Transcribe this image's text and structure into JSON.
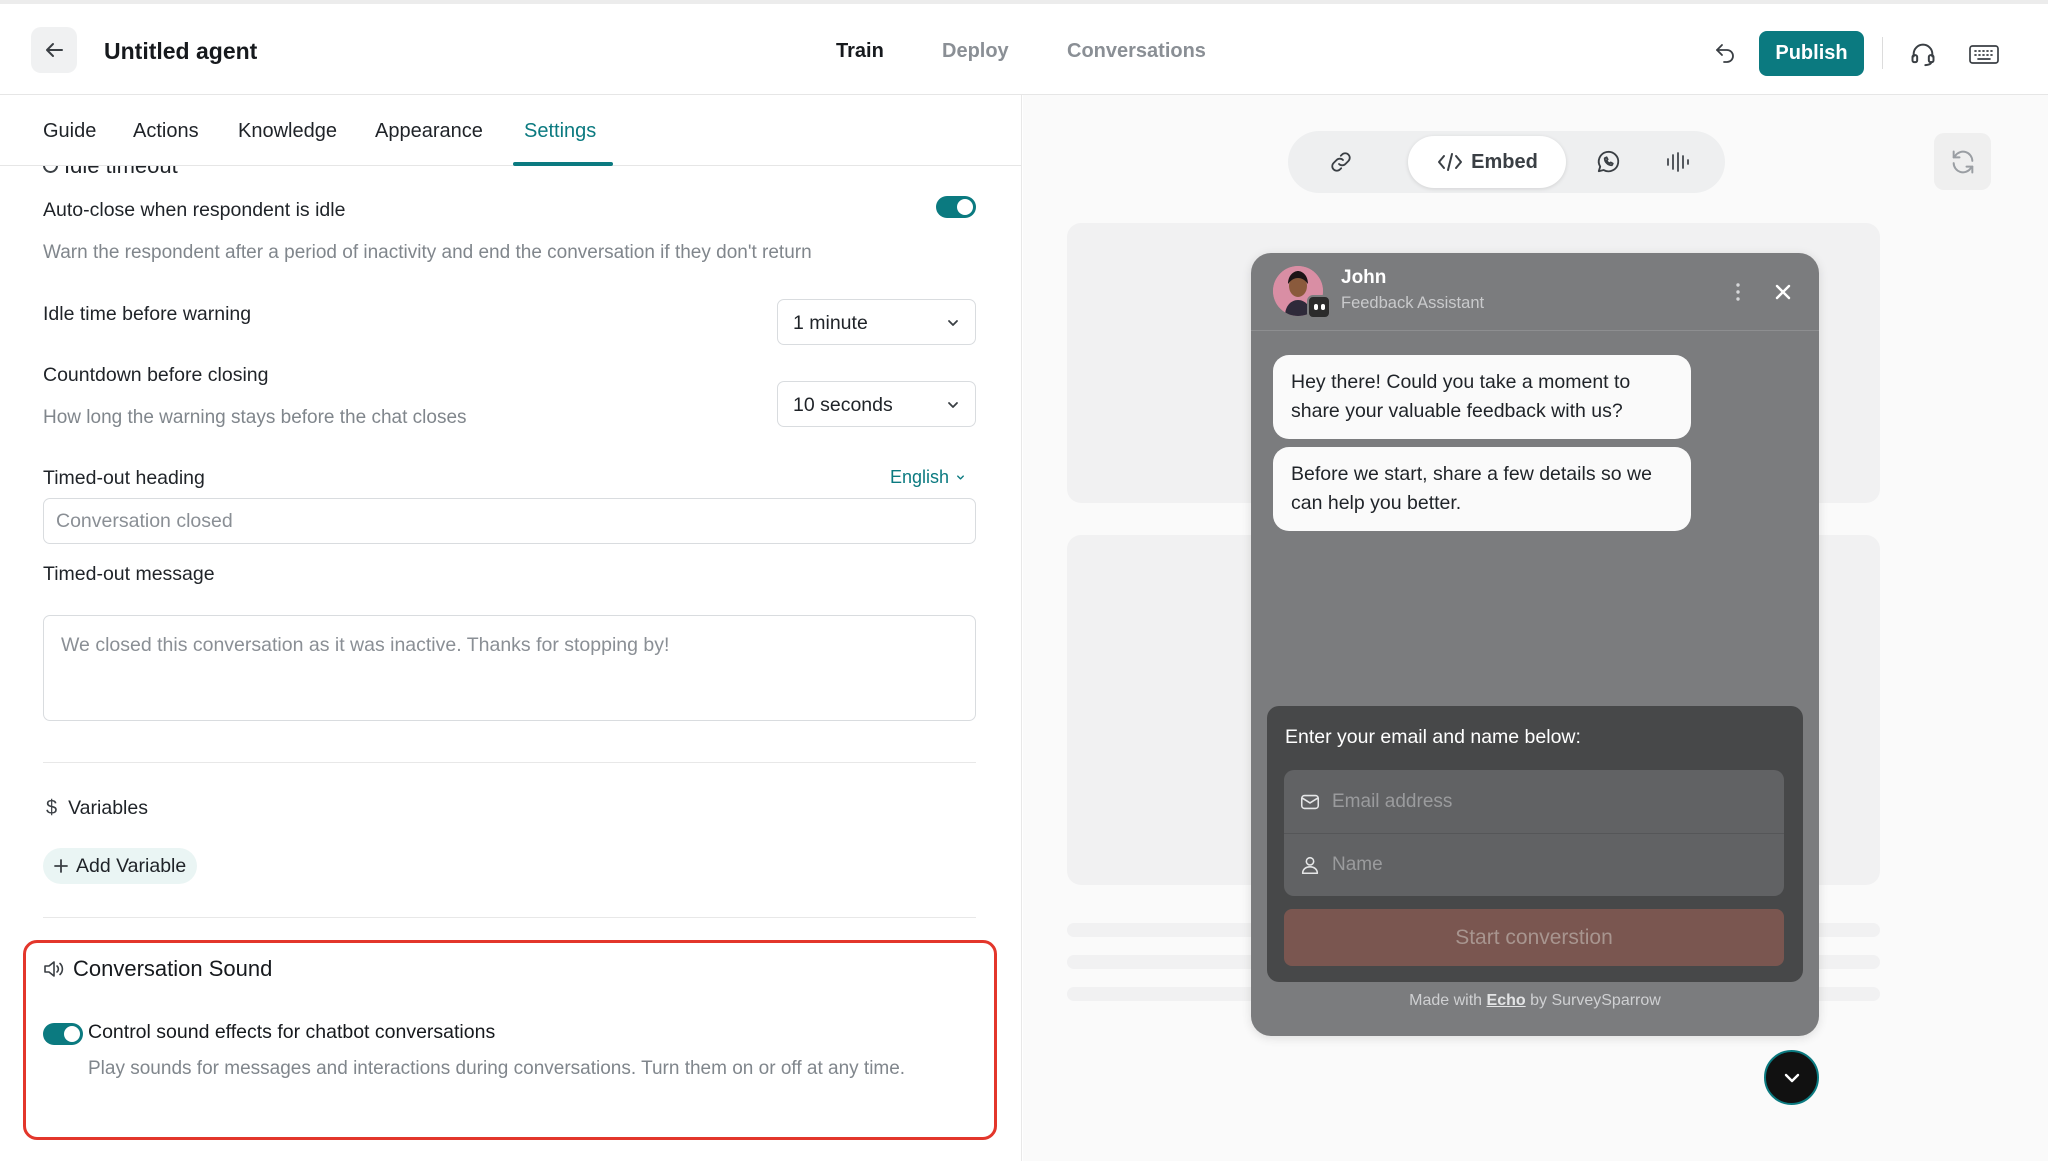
{
  "header": {
    "title": "Untitled agent",
    "tabs": [
      {
        "label": "Train",
        "active": true
      },
      {
        "label": "Deploy",
        "active": false
      },
      {
        "label": "Conversations",
        "active": false
      }
    ],
    "publish_label": "Publish",
    "icons": [
      "arrow-left-icon",
      "undo-icon",
      "headset-icon",
      "keyboard-icon"
    ]
  },
  "subtabs": [
    {
      "label": "Guide",
      "active": false
    },
    {
      "label": "Actions",
      "active": false
    },
    {
      "label": "Knowledge",
      "active": false
    },
    {
      "label": "Appearance",
      "active": false
    },
    {
      "label": "Settings",
      "active": true
    }
  ],
  "settings": {
    "section_heading": "Idle timeout",
    "auto_close": {
      "label": "Auto-close when respondent is idle",
      "description": "Warn the respondent after a period of inactivity and end the conversation if they don't return",
      "enabled": true
    },
    "idle_time": {
      "label": "Idle time before warning",
      "value": "1 minute"
    },
    "countdown": {
      "label": "Countdown before closing",
      "description": "How long the warning stays before the chat closes",
      "value": "10 seconds"
    },
    "timed_out_heading": {
      "label": "Timed-out heading",
      "language": "English",
      "placeholder": "Conversation closed"
    },
    "timed_out_message": {
      "label": "Timed-out message",
      "placeholder": "We closed this conversation as it was inactive. Thanks for stopping by!"
    }
  },
  "variables": {
    "title": "Variables",
    "add_label": "Add Variable"
  },
  "conversation_sound": {
    "title": "Conversation Sound",
    "toggle_label": "Control sound effects for chatbot conversations",
    "description": "Play sounds for messages and interactions during conversations. Turn them on or off at any time.",
    "enabled": true
  },
  "preview": {
    "channels": [
      {
        "icon": "link-icon",
        "label": ""
      },
      {
        "icon": "code-icon",
        "label": "Embed",
        "active": true
      },
      {
        "icon": "whatsapp-icon",
        "label": ""
      },
      {
        "icon": "voice-wave-icon",
        "label": ""
      }
    ],
    "widget": {
      "bot_name": "John",
      "bot_role": "Feedback Assistant",
      "messages": [
        "Hey there! Could you take a moment to share your valuable feedback with us?",
        "Before we start, share a few details so we can help you better."
      ],
      "form": {
        "title": "Enter your email and name below:",
        "email_placeholder": "Email address",
        "name_placeholder": "Name",
        "submit_label": "Start converstion"
      },
      "footer": {
        "prefix": "Made with ",
        "brand": "Echo",
        "suffix": " by SurveySparrow"
      }
    }
  },
  "colors": {
    "accent": "#0b7a80",
    "highlight_border": "#e3362b",
    "widget_bg": "#7b7c7e",
    "start_button": "#7a5650"
  }
}
